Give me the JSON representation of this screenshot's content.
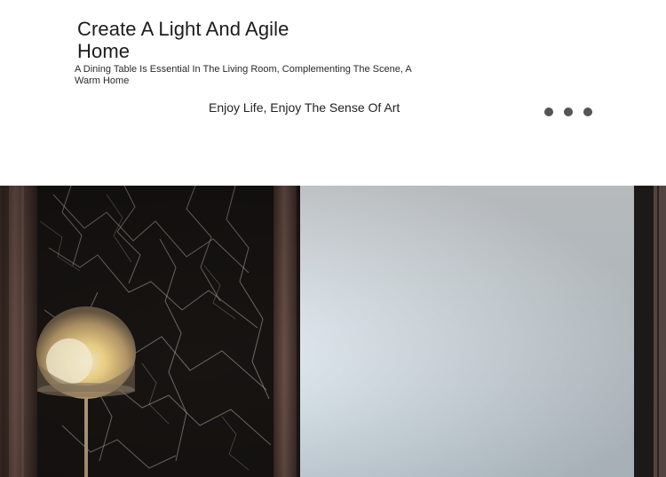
{
  "hero": {
    "title": "Create A Light And Agile Home",
    "subtitle": "A Dining Table Is Essential In The Living Room, Complementing The Scene, A Warm Home",
    "tagline": "Enjoy Life, Enjoy The Sense Of Art"
  },
  "carousel": {
    "dots": 3
  },
  "colors": {
    "text": "#1c1c1c",
    "dot": "#555555",
    "wall": "#4c3a34",
    "marble": "#171412",
    "window": "#e7f1f7"
  }
}
